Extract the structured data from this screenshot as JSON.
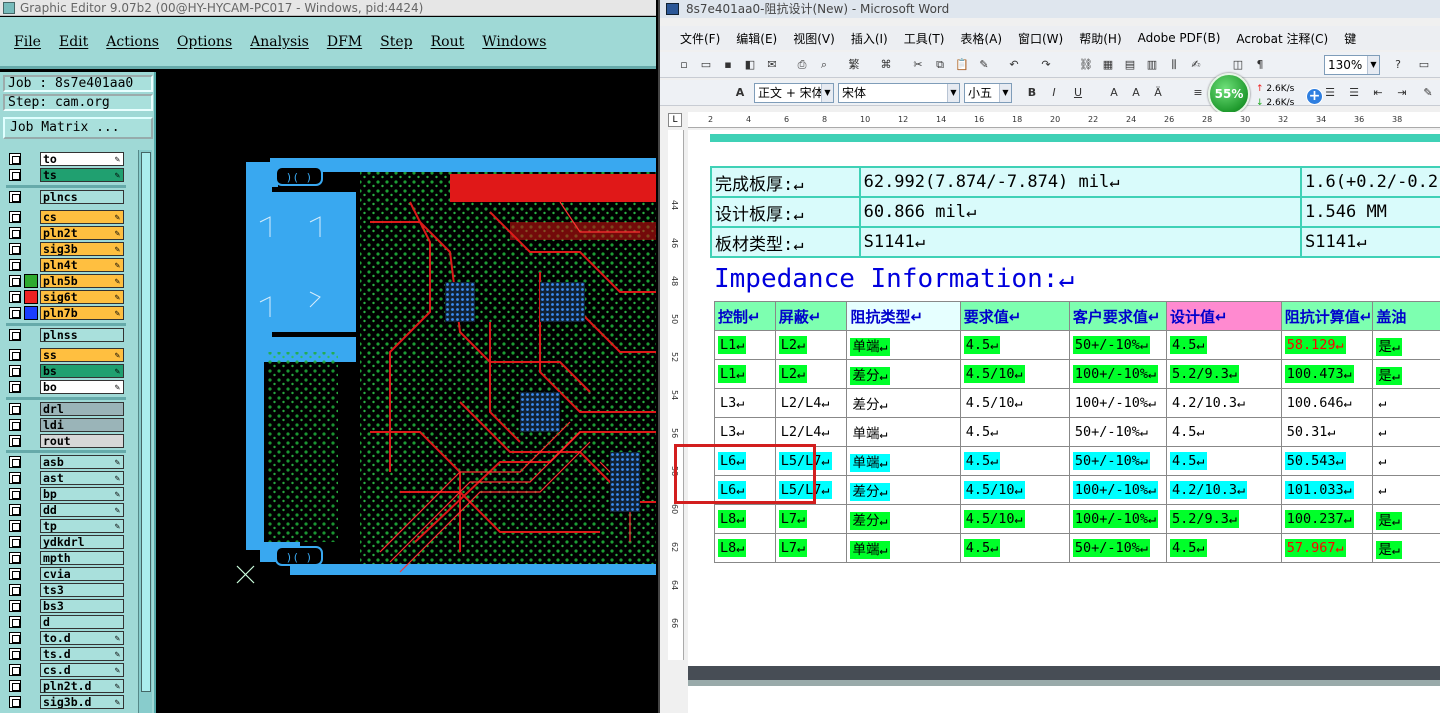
{
  "ge": {
    "title": "Graphic Editor 9.07b2 (00@HY-HYCAM-PC017 - Windows, pid:4424)",
    "menu": [
      "File",
      "Edit",
      "Actions",
      "Options",
      "Analysis",
      "DFM",
      "Step",
      "Rout",
      "Windows"
    ],
    "job_label": "Job : 8s7e401aa0",
    "step_label": "Step: cam.org",
    "job_matrix_label": "Job Matrix ...",
    "layers": [
      {
        "name": "to",
        "color": "#ffffff",
        "swatch": "",
        "tag": "✎"
      },
      {
        "name": "ts",
        "color": "#20a070",
        "swatch": "",
        "tag": "✎"
      },
      {
        "name": "plncs",
        "color": "#a9e0dc",
        "swatch": "",
        "tag": ""
      },
      {
        "name": "cs",
        "color": "#ffbf40",
        "swatch": "",
        "tag": "✎"
      },
      {
        "name": "pln2t",
        "color": "#ffbf40",
        "swatch": "",
        "tag": "✎"
      },
      {
        "name": "sig3b",
        "color": "#ffbf40",
        "swatch": "",
        "tag": "✎"
      },
      {
        "name": "pln4t",
        "color": "#ffbf40",
        "swatch": "",
        "tag": "✎"
      },
      {
        "name": "pln5b",
        "color": "#ffbf40",
        "swatch": "#2eaa2e",
        "tag": "✎"
      },
      {
        "name": "sig6t",
        "color": "#ffbf40",
        "swatch": "#ee2222",
        "tag": "✎"
      },
      {
        "name": "pln7b",
        "color": "#ffbf40",
        "swatch": "#1a3fff",
        "tag": "✎"
      },
      {
        "name": "plnss",
        "color": "#a9e0dc",
        "swatch": "",
        "tag": ""
      },
      {
        "name": "ss",
        "color": "#ffbf40",
        "swatch": "",
        "tag": "✎"
      },
      {
        "name": "bs",
        "color": "#20a070",
        "swatch": "",
        "tag": "✎"
      },
      {
        "name": "bo",
        "color": "#ffffff",
        "swatch": "",
        "tag": "✎"
      },
      {
        "name": "drl",
        "color": "#9ab4b8",
        "swatch": "",
        "tag": ""
      },
      {
        "name": "ldi",
        "color": "#9ab4b8",
        "swatch": "",
        "tag": ""
      },
      {
        "name": "rout",
        "color": "#d7d7d7",
        "swatch": "",
        "tag": ""
      },
      {
        "name": "asb",
        "color": "#a9e0dc",
        "swatch": "",
        "tag": "✎"
      },
      {
        "name": "ast",
        "color": "#a9e0dc",
        "swatch": "",
        "tag": "✎"
      },
      {
        "name": "bp",
        "color": "#a9e0dc",
        "swatch": "",
        "tag": "✎"
      },
      {
        "name": "dd",
        "color": "#a9e0dc",
        "swatch": "",
        "tag": "✎"
      },
      {
        "name": "tp",
        "color": "#a9e0dc",
        "swatch": "",
        "tag": "✎"
      },
      {
        "name": "ydkdrl",
        "color": "#a9e0dc",
        "swatch": "",
        "tag": ""
      },
      {
        "name": "mpth",
        "color": "#a9e0dc",
        "swatch": "",
        "tag": ""
      },
      {
        "name": "cvia",
        "color": "#a9e0dc",
        "swatch": "",
        "tag": ""
      },
      {
        "name": "ts3",
        "color": "#a9e0dc",
        "swatch": "",
        "tag": ""
      },
      {
        "name": "bs3",
        "color": "#a9e0dc",
        "swatch": "",
        "tag": ""
      },
      {
        "name": "d",
        "color": "#a9e0dc",
        "swatch": "",
        "tag": ""
      },
      {
        "name": "to.d",
        "color": "#a9e0dc",
        "swatch": "",
        "tag": "✎"
      },
      {
        "name": "ts.d",
        "color": "#a9e0dc",
        "swatch": "",
        "tag": "✎"
      },
      {
        "name": "cs.d",
        "color": "#a9e0dc",
        "swatch": "",
        "tag": "✎"
      },
      {
        "name": "pln2t.d",
        "color": "#a9e0dc",
        "swatch": "",
        "tag": "✎"
      },
      {
        "name": "sig3b.d",
        "color": "#a9e0dc",
        "swatch": "",
        "tag": "✎"
      }
    ]
  },
  "word": {
    "title": "8s7e401aa0-阻抗设计(New) - Microsoft Word",
    "menu": [
      "文件(F)",
      "编辑(E)",
      "视图(V)",
      "插入(I)",
      "工具(T)",
      "表格(A)",
      "窗口(W)",
      "帮助(H)",
      "Adobe PDF(B)",
      "Acrobat 注释(C)",
      "键"
    ],
    "zoom": "130%",
    "style_combo": "正文 + 宋体",
    "font_combo": "宋体",
    "size_combo": "小五",
    "net": {
      "percent": "55%",
      "up": "2.6K/s",
      "down": "2.6K/s"
    },
    "ruler_h": [
      "2",
      "4",
      "6",
      "8",
      "10",
      "12",
      "14",
      "16",
      "18",
      "20",
      "22",
      "24",
      "26",
      "28",
      "30",
      "32",
      "34",
      "36",
      "38"
    ],
    "ruler_v": [
      "44",
      "46",
      "48",
      "50",
      "52",
      "54",
      "56",
      "58",
      "60",
      "62",
      "64",
      "66"
    ],
    "info_rows": [
      [
        "完成板厚:↵",
        "62.992(7.874/-7.874) mil↵",
        "1.6(+0.2/-0.2"
      ],
      [
        "设计板厚:↵",
        "60.866 mil↵",
        "1.546 MM"
      ],
      [
        "板材类型:↵",
        "S1141↵",
        "S1141↵"
      ]
    ],
    "impedance_title": "Impedance Information:↵",
    "headers": [
      "控制↵",
      "屏蔽↵",
      "阻抗类型↵",
      "要求值↵",
      "客户要求值↵",
      "设计值↵",
      "阻抗计算值↵",
      "盖油"
    ],
    "rows": [
      {
        "hl": "g",
        "cells": [
          "L1↵",
          "L2↵",
          "单端↵",
          "4.5↵",
          "50+/-10%↵",
          "4.5↵",
          "58.129↵",
          "是↵"
        ],
        "red": true
      },
      {
        "hl": "g",
        "cells": [
          "L1↵",
          "L2↵",
          "差分↵",
          "4.5/10↵",
          "100+/-10%↵",
          "5.2/9.3↵",
          "100.473↵",
          "是↵"
        ],
        "red": false
      },
      {
        "hl": "n",
        "cells": [
          "L3↵",
          "L2/L4↵",
          "差分↵",
          "4.5/10↵",
          "100+/-10%↵",
          "4.2/10.3↵",
          "100.646↵",
          "↵"
        ],
        "red": false
      },
      {
        "hl": "n",
        "cells": [
          "L3↵",
          "L2/L4↵",
          "单端↵",
          "4.5↵",
          "50+/-10%↵",
          "4.5↵",
          "50.31↵",
          "↵"
        ],
        "red": false
      },
      {
        "hl": "c",
        "cells": [
          "L6↵",
          "L5/L7↵",
          "单端↵",
          "4.5↵",
          "50+/-10%↵",
          "4.5↵",
          "50.543↵",
          "↵"
        ],
        "red": false
      },
      {
        "hl": "c",
        "cells": [
          "L6↵",
          "L5/L7↵",
          "差分↵",
          "4.5/10↵",
          "100+/-10%↵",
          "4.2/10.3↵",
          "101.033↵",
          "↵"
        ],
        "red": false
      },
      {
        "hl": "g",
        "cells": [
          "L8↵",
          "L7↵",
          "差分↵",
          "4.5/10↵",
          "100+/-10%↵",
          "5.2/9.3↵",
          "100.237↵",
          "是↵"
        ],
        "red": false
      },
      {
        "hl": "g",
        "cells": [
          "L8↵",
          "L7↵",
          "单端↵",
          "4.5↵",
          "50+/-10%↵",
          "4.5↵",
          "57.967↵",
          "是↵"
        ],
        "red": true
      }
    ],
    "header_colors": [
      "#7dffb0",
      "#7dffb0",
      "#e6ffff",
      "#7dffb0",
      "#7dffb0",
      "#ff8ad0",
      "#7dffb0",
      "#7dffb0"
    ]
  }
}
